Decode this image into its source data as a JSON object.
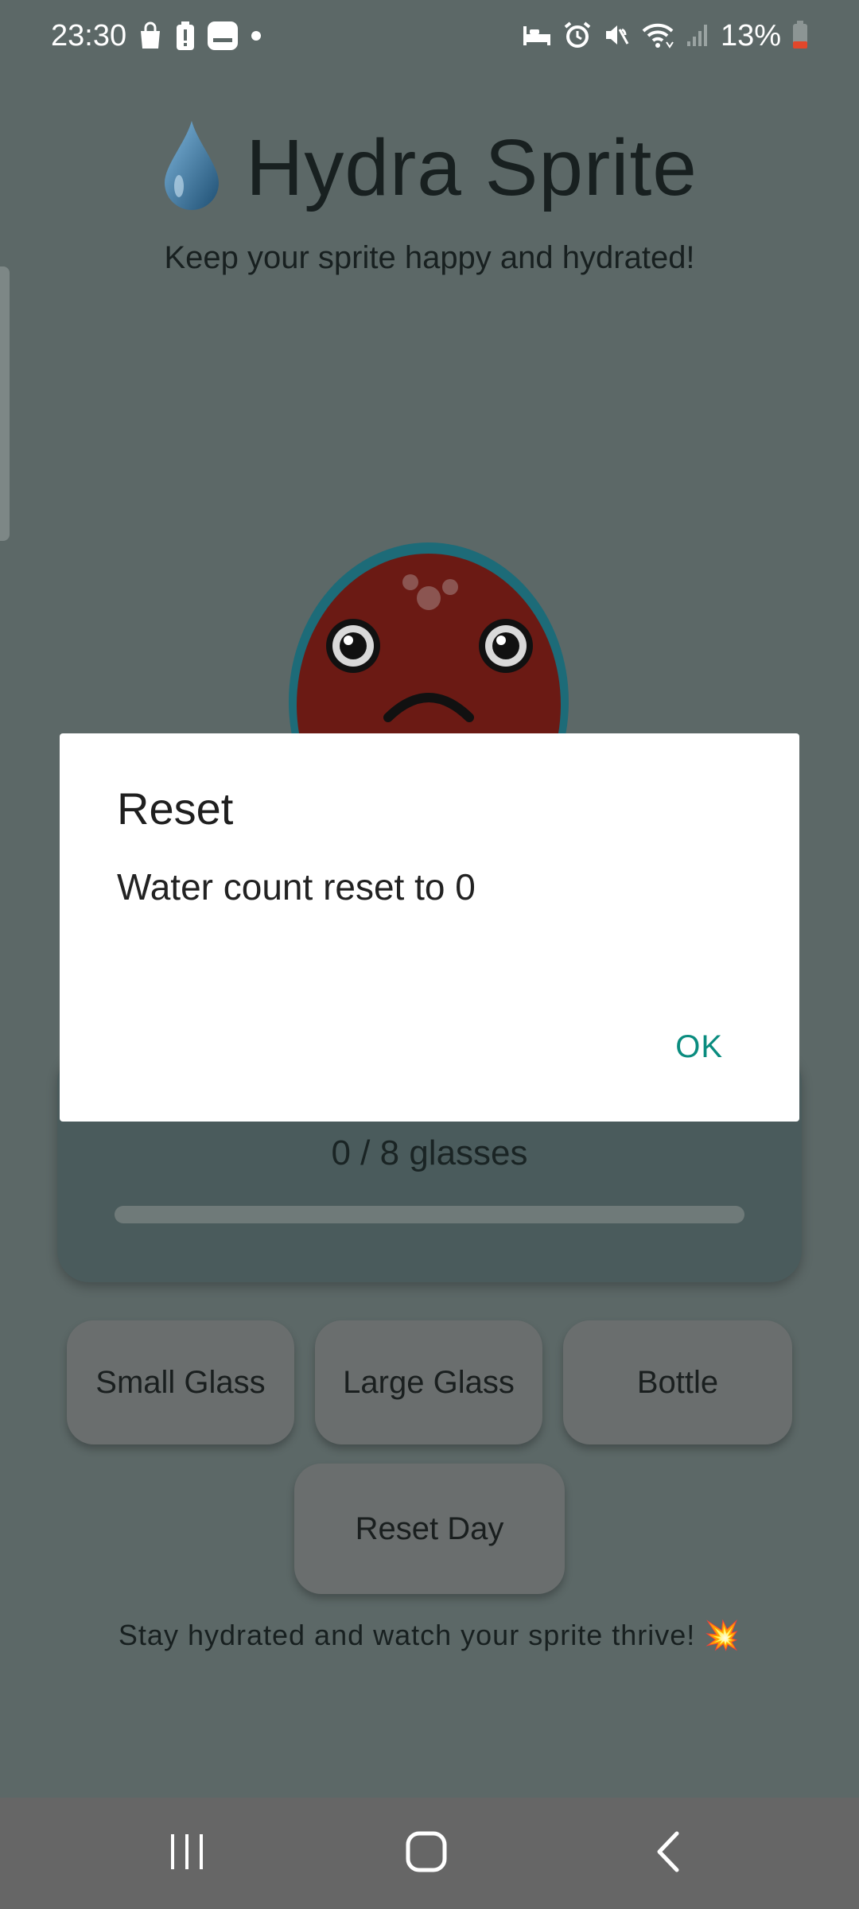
{
  "status_bar": {
    "time": "23:30",
    "battery_percent": "13%",
    "icons": [
      "shopping-bag-icon",
      "battery-alert-icon",
      "gallery-icon",
      "dot-icon",
      "bed-icon",
      "alarm-icon",
      "mute-icon",
      "wifi-icon",
      "signal-icon",
      "battery-icon"
    ]
  },
  "header": {
    "title": "Hydra Sprite",
    "subtitle": "Keep your sprite happy and hydrated!",
    "logo_icon": "water-drop-icon"
  },
  "sprite": {
    "mood": "sad",
    "body_color": "#6b1a14",
    "outline_color": "#1d6b78"
  },
  "progress": {
    "text": "0 / 8 glasses",
    "current": 0,
    "goal": 8
  },
  "buttons": {
    "small_glass": "Small Glass",
    "large_glass": "Large Glass",
    "bottle": "Bottle",
    "reset_day": "Reset Day"
  },
  "footer": {
    "text": "Stay hydrated and watch your sprite thrive! 💥"
  },
  "dialog": {
    "title": "Reset",
    "message": "Water count reset to 0",
    "ok_label": "OK",
    "accent_color": "#0a8c7f"
  },
  "nav_bar": {
    "icons": [
      "recent-apps-icon",
      "home-icon",
      "back-icon"
    ]
  }
}
